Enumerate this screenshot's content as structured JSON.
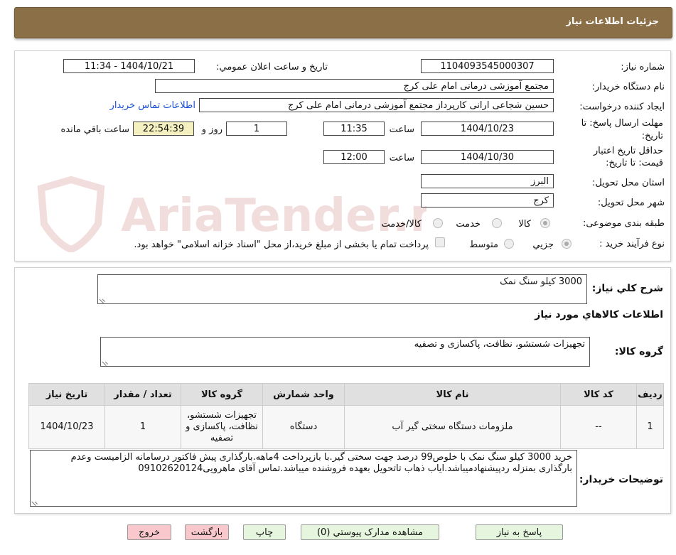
{
  "header": {
    "title": "جزئیات اطلاعات نیاز"
  },
  "form": {
    "need_number_label": "شماره نیاز:",
    "need_number": "1104093545000307",
    "announce_label": "تاریخ و ساعت اعلان عمومي:",
    "announce_value": "1404/10/21 - 11:34",
    "buyer_org_label": "نام دستگاه خريدار:",
    "buyer_org": "مجتمع آموزشی درمانی امام علی کرج",
    "requester_label": "ايجاد کننده درخواست:",
    "requester": "حسین شجاعی ارانی کارپرداز مجتمع آموزشی درمانی امام علی کرج",
    "contact_link": "اطلاعات تماس خريدار",
    "reply_deadline_label_1": "مهلت ارسال پاسخ: تا",
    "reply_deadline_label_2": "تاريخ:",
    "reply_date": "1404/10/23",
    "time_label": "ساعت",
    "reply_time": "11:35",
    "days_value": "1",
    "days_label": "روز و",
    "remaining_time": "22:54:39",
    "remaining_label": "ساعت باقي مانده",
    "validity_label_1": "حداقل تاريخ اعتبار",
    "validity_label_2": "قيمت: تا تاريخ:",
    "validity_date": "1404/10/30",
    "validity_time": "12:00",
    "province_label": "استان محل تحويل:",
    "province": "البرز",
    "city_label": "شهر محل تحويل:",
    "city": "کرج",
    "category_label": "طبقه بندی موضوعی:",
    "category_options": [
      "کالا",
      "خدمت",
      "کالا/خدمت"
    ],
    "process_label": "نوع فرآیند خرید :",
    "process_options": [
      "جزيي",
      "متوسط"
    ],
    "payment_note": "پرداخت تمام يا بخشی از مبلغ خريد،از محل \"اسناد خزانه اسلامی\" خواهد بود."
  },
  "summary": {
    "label": "شرح کلي نياز:",
    "value": "3000 کیلو سنگ نمک"
  },
  "goods": {
    "section_title": "اطلاعات کالاهاي مورد نياز",
    "group_label": "گروه کالا:",
    "group_value": "تجهیزات شستشو، نظافت، پاکسازی و تصفیه"
  },
  "table": {
    "headers": [
      "رديف",
      "کد کالا",
      "نام کالا",
      "واحد شمارش",
      "گروه کالا",
      "تعداد / مقدار",
      "تاريخ نياز"
    ],
    "rows": [
      [
        "1",
        "--",
        "ملزومات دستگاه سختی گیر آب",
        "دستگاه",
        "تجهیزات شستشو، نظافت، پاکسازی و تصفیه",
        "1",
        "1404/10/23"
      ]
    ]
  },
  "buyer_notes": {
    "label": "توضيحات خريدار:",
    "value": "خرید 3000 کیلو سنگ نمک با خلوص99 درصد جهت سختی گیر.با بازپرداخت 4ماهه.بارگذاری پیش فاکتور درسامانه الزامیست وعدم بارگذاری بمنزله ردپیشنهادمیباشد.ایاب ذهاب تاتحویل بعهده فروشنده میباشد.تماس آقای ماهرویی09102620124"
  },
  "buttons": {
    "reply": "پاسخ به نياز",
    "attachments": "مشاهده مدارک پيوستي (0)",
    "print": "چاپ",
    "back": "بازگشت",
    "exit": "خروج"
  },
  "colors": {
    "header_bg": "#8b6f47",
    "link": "#1a4fd6",
    "remaining_bg": "#f5f0c0"
  }
}
